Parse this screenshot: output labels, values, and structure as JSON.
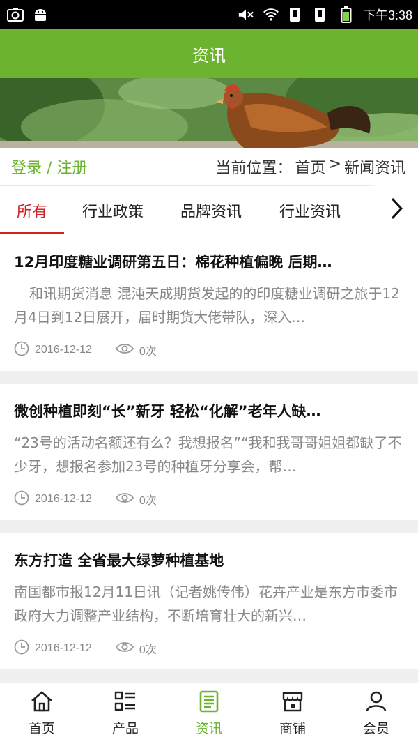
{
  "status": {
    "time": "下午3:38"
  },
  "header": {
    "title": "资讯"
  },
  "location_bar": {
    "login_link": "登录 / 注册",
    "position_label": "当前位置：",
    "home_link": "首页",
    "separator": ">",
    "current": "新闻资讯"
  },
  "tabs": [
    {
      "label": "所有",
      "active": true
    },
    {
      "label": "行业政策",
      "active": false
    },
    {
      "label": "品牌资讯",
      "active": false
    },
    {
      "label": "行业资讯",
      "active": false
    }
  ],
  "articles": [
    {
      "title": "12月印度糖业调研第五日：棉花种植偏晚 后期…",
      "summary": "和讯期货消息 混沌天成期货发起的的印度糖业调研之旅于12月4日到12日展开，届时期货大佬带队，深入…",
      "date": "2016-12-12",
      "views": "0次"
    },
    {
      "title": "微创种植即刻“长”新牙 轻松“化解”老年人缺…",
      "summary": "“23号的活动名额还有么？我想报名”“我和我哥哥姐姐都缺了不少牙，想报名参加23号的种植牙分享会，帮…",
      "date": "2016-12-12",
      "views": "0次"
    },
    {
      "title": "东方打造 全省最大绿萝种植基地",
      "summary": "南国都市报12月11日讯（记者姚传伟）花卉产业是东方市委市政府大力调整产业结构，不断培育壮大的新兴…",
      "date": "2016-12-12",
      "views": "0次"
    }
  ],
  "bottom_nav": [
    {
      "label": "首页",
      "icon": "home-icon",
      "active": false
    },
    {
      "label": "产品",
      "icon": "grid-list-icon",
      "active": false
    },
    {
      "label": "资讯",
      "icon": "news-icon",
      "active": true
    },
    {
      "label": "商铺",
      "icon": "shop-icon",
      "active": false
    },
    {
      "label": "会员",
      "icon": "user-icon",
      "active": false
    }
  ],
  "colors": {
    "brand_green": "#6cb430",
    "active_red": "#d42020"
  }
}
